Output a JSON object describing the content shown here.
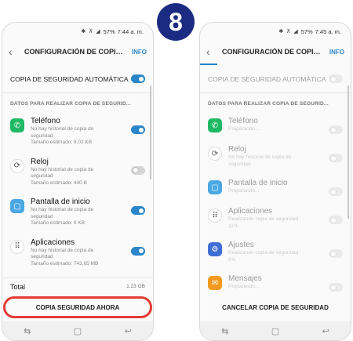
{
  "step_badge": "8",
  "left": {
    "status": {
      "icons": "✱ ⊼ ◢",
      "battery": "57%",
      "time": "7:44 a. m."
    },
    "title": "CONFIGURACIÓN DE COPIA D...",
    "info": "INFO",
    "auto_backup_label": "COPIA DE SEGURIDAD AUTOMÁTICA",
    "section": "DATOS PARA REALIZAR COPIA DE SEGURID...",
    "apps": [
      {
        "name": "Teléfono",
        "line1": "No hay historial de copia de",
        "line2": "seguridad",
        "line3": "Tamaño estimado: 9,02 KB",
        "toggle_on": true,
        "icon": "phone-icon",
        "color": "#1fb864",
        "glyph": "✆"
      },
      {
        "name": "Reloj",
        "line1": "No hay historial de copia de",
        "line2": "seguridad",
        "line3": "Tamaño estimado: 440 B",
        "toggle_on": false,
        "icon": "clock-icon",
        "color": "#ffffff",
        "glyph": "⟳"
      },
      {
        "name": "Pantalla de inicio",
        "line1": "No hay historial de copia de",
        "line2": "seguridad",
        "line3": "Tamaño estimado: 9 KB",
        "toggle_on": true,
        "icon": "home-screen-icon",
        "color": "#4aa7e2",
        "glyph": "▢"
      },
      {
        "name": "Aplicaciones",
        "line1": "No hay historial de copia de",
        "line2": "seguridad",
        "line3": "Tamaño estimado: 743,65 MB",
        "toggle_on": true,
        "icon": "apps-grid-icon",
        "color": "#ffffff",
        "glyph": "⠿"
      }
    ],
    "total_label": "Total",
    "total_value": "1,23 GB",
    "button": "COPIA SEGURIDAD AHORA"
  },
  "right": {
    "status": {
      "icons": "✱ ⊼ ◢",
      "battery": "57%",
      "time": "7:45 a. m."
    },
    "title": "CONFIGURACIÓN DE COPIA D...",
    "info": "INFO",
    "auto_backup_label": "COPIA DE SEGURIDAD AUTOMÁTICA",
    "section": "DATOS PARA REALIZAR COPIA DE SEGURID...",
    "apps": [
      {
        "name": "Teléfono",
        "line1": "Preparando...",
        "line2": "",
        "icon": "phone-icon",
        "color": "#1fb864",
        "glyph": "✆"
      },
      {
        "name": "Reloj",
        "line1": "No hay historial de copia de",
        "line2": "seguridad",
        "icon": "clock-icon",
        "color": "#ffffff",
        "glyph": "⟳"
      },
      {
        "name": "Pantalla de inicio",
        "line1": "Preparando...",
        "line2": "",
        "icon": "home-screen-icon",
        "color": "#4aa7e2",
        "glyph": "▢"
      },
      {
        "name": "Aplicaciones",
        "line1": "Realizando copia de seguridad:",
        "line2": "11%",
        "icon": "apps-grid-icon",
        "color": "#ffffff",
        "glyph": "⠿"
      },
      {
        "name": "Ajustes",
        "line1": "Realizando copia de seguridad:",
        "line2": "6%",
        "icon": "settings-icon",
        "color": "#3f6fd4",
        "glyph": "⚙"
      },
      {
        "name": "Mensajes",
        "line1": "Preparando...",
        "line2": "",
        "icon": "messages-icon",
        "color": "#f39a1e",
        "glyph": "✉"
      }
    ],
    "button": "CANCELAR COPIA DE SEGURIDAD"
  },
  "nav": {
    "recent": "⇆",
    "home": "▢",
    "back": "↩"
  }
}
